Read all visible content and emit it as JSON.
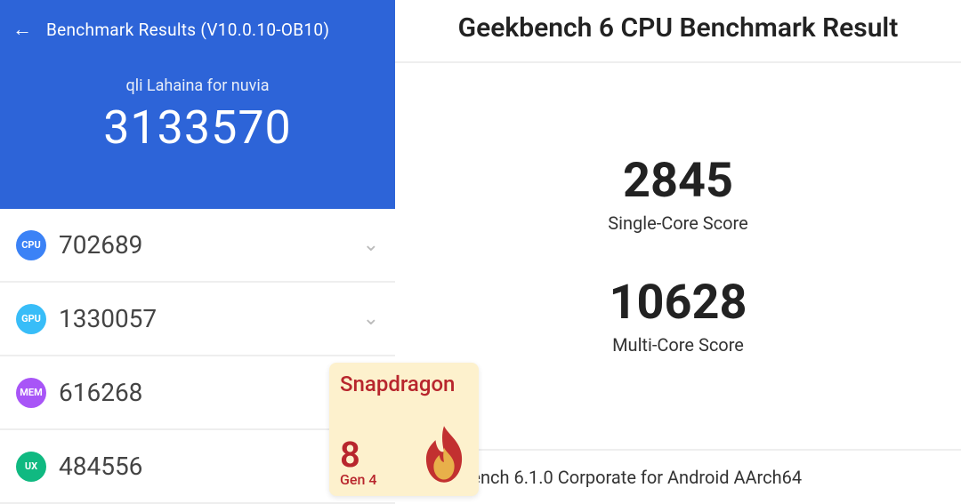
{
  "antutu": {
    "toolbar_title": "Benchmark Results (V10.0.10-OB10)",
    "device_name": "qli Lahaina for nuvia",
    "total_score": "3133570",
    "rows": [
      {
        "badge": "CPU",
        "value": "702689",
        "expandable": true
      },
      {
        "badge": "GPU",
        "value": "1330057",
        "expandable": true
      },
      {
        "badge": "MEM",
        "value": "616268",
        "expandable": false
      },
      {
        "badge": "UX",
        "value": "484556",
        "expandable": false
      }
    ]
  },
  "geekbench": {
    "title": "Geekbench 6 CPU Benchmark Result",
    "single_core": "2845",
    "single_core_label": "Single-Core Score",
    "multi_core": "10628",
    "multi_core_label": "Multi-Core Score",
    "footer": "kbench 6.1.0 Corporate for Android AArch64"
  },
  "snapdragon": {
    "brand": "Snapdragon",
    "number": "8",
    "gen": "Gen 4"
  }
}
